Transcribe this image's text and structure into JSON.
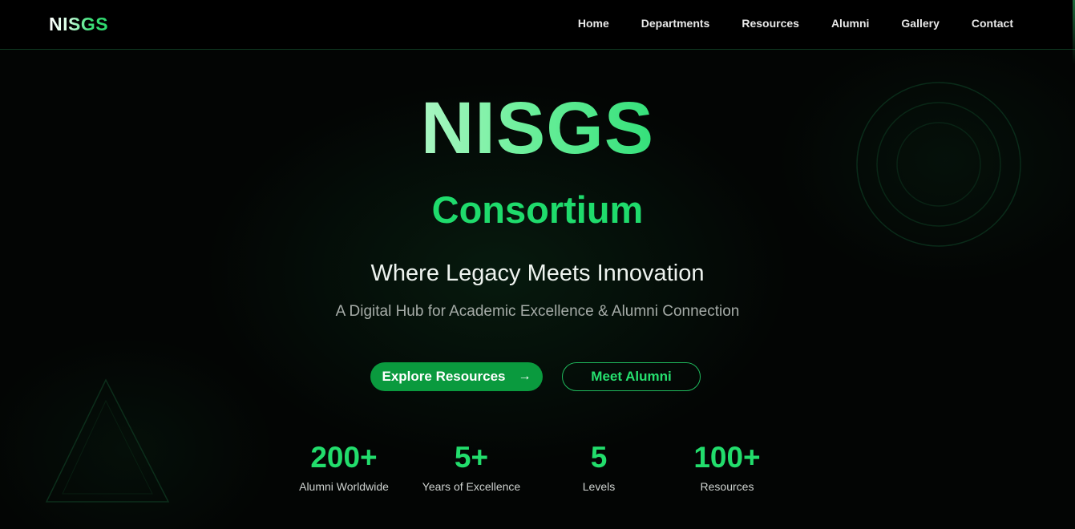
{
  "nav": {
    "logo_part1": "NI",
    "logo_part2": "SGS",
    "links": [
      "Home",
      "Departments",
      "Resources",
      "Alumni",
      "Gallery",
      "Contact"
    ]
  },
  "hero": {
    "title": "NISGS",
    "subtitle": "Consortium",
    "tagline": "Where Legacy Meets Innovation",
    "description": "A Digital Hub for Academic Excellence & Alumni Connection"
  },
  "buttons": {
    "primary_label": "Explore Resources",
    "primary_icon": "→",
    "secondary_label": "Meet Alumni"
  },
  "stats": [
    {
      "value": "200+",
      "label": "Alumni Worldwide"
    },
    {
      "value": "5+",
      "label": "Years of Excellence"
    },
    {
      "value": "5",
      "label": "Levels"
    },
    {
      "value": "100+",
      "label": "Resources"
    }
  ],
  "colors": {
    "accent": "#22dd6c",
    "primary_button": "#0a9a3e",
    "background": "#030504"
  }
}
